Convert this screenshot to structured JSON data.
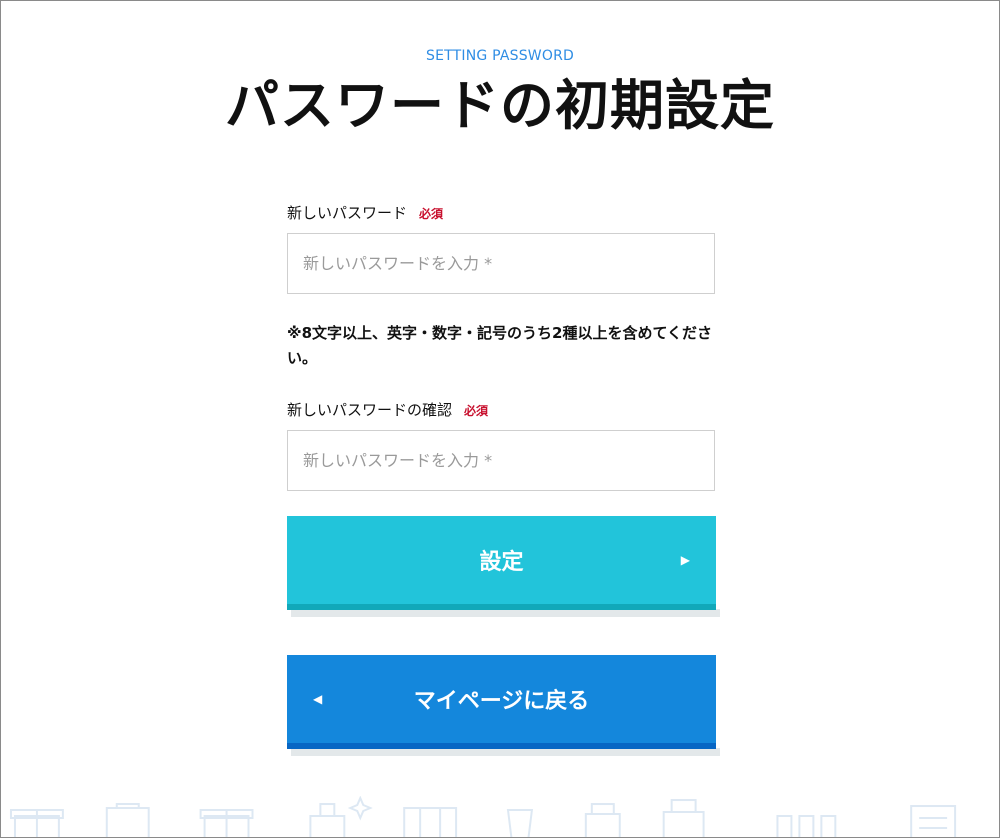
{
  "header": {
    "eyebrow": "SETTING PASSWORD",
    "title": "パスワードの初期設定"
  },
  "form": {
    "new_password": {
      "label": "新しいパスワード",
      "required": "必須",
      "placeholder": "新しいパスワードを入力 *",
      "value": ""
    },
    "hint": "※8文字以上、英字・数字・記号のうち2種以上を含めてください。",
    "confirm_password": {
      "label": "新しいパスワードの確認",
      "required": "必須",
      "placeholder": "新しいパスワードを入力 *",
      "value": ""
    }
  },
  "buttons": {
    "submit": {
      "label": "設定",
      "arrow": "▶"
    },
    "back": {
      "label": "マイページに戻る",
      "arrow": "◀"
    }
  },
  "colors": {
    "accent_text": "#2f8de4",
    "required": "#c8102e",
    "submit_bg": "#22c4da",
    "submit_edge": "#11a8b9",
    "back_bg": "#1487dc",
    "back_edge": "#0766c4",
    "decor_stroke": "#dde8f3"
  }
}
